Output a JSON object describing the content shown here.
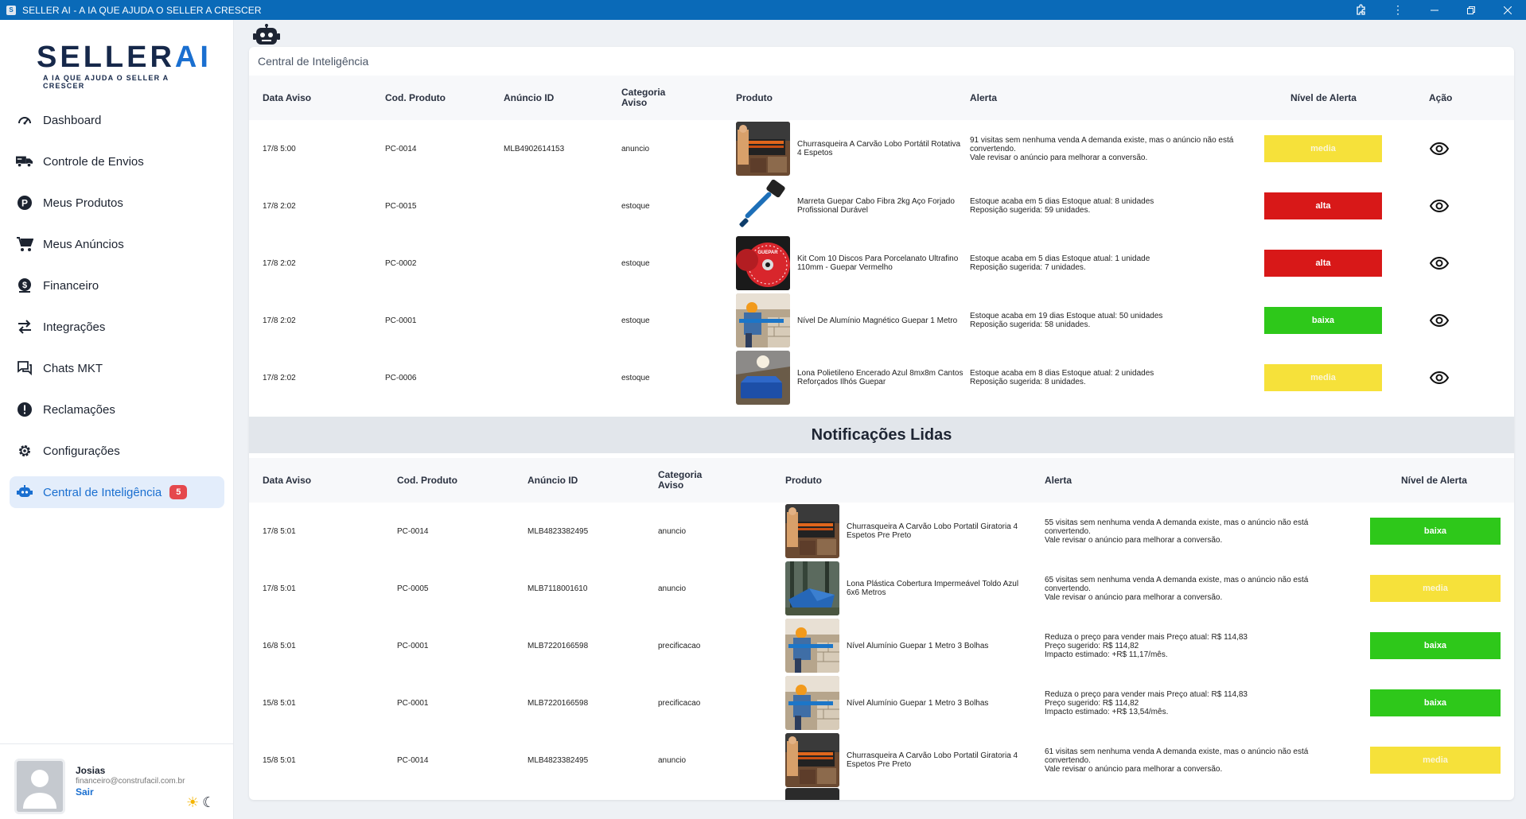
{
  "window": {
    "title": "SELLER AI - A IA QUE AJUDA O SELLER A CRESCER",
    "icon_letter": "S"
  },
  "logo": {
    "main_a": "SELLER",
    "main_b": "AI",
    "tagline": "A IA QUE AJUDA O SELLER A CRESCER"
  },
  "sidebar": {
    "items": [
      {
        "label": "Dashboard",
        "icon": "speedometer-icon"
      },
      {
        "label": "Controle de Envios",
        "icon": "truck-icon"
      },
      {
        "label": "Meus Produtos",
        "icon": "product-p-icon"
      },
      {
        "label": "Meus Anúncios",
        "icon": "cart-icon"
      },
      {
        "label": "Financeiro",
        "icon": "dollar-icon"
      },
      {
        "label": "Integrações",
        "icon": "swap-arrows-icon"
      },
      {
        "label": "Chats MKT",
        "icon": "chat-icon"
      },
      {
        "label": "Reclamações",
        "icon": "alert-icon"
      },
      {
        "label": "Configurações",
        "icon": "gear-icon"
      },
      {
        "label": "Central de Inteligência",
        "icon": "robot-icon",
        "badge": "5",
        "active": true
      }
    ]
  },
  "user": {
    "name": "Josias",
    "email": "financeiro@construfacil.com.br",
    "logout": "Sair"
  },
  "page": {
    "title": "Central de Inteligência"
  },
  "unread": {
    "headers": [
      "Data Aviso",
      "Cod. Produto",
      "Anúncio ID",
      "Categoria Aviso",
      "Produto",
      "Alerta",
      "Nível de Alerta",
      "Ação"
    ],
    "rows": [
      {
        "date": "17/8 5:00",
        "code": "PC-0014",
        "ad_id": "MLB4902614153",
        "category": "anuncio",
        "product": "Churrasqueira A Carvão Lobo Portátil Rotativa 4 Espetos",
        "img": "grill",
        "alert": "91 visitas sem nenhuma venda A demanda existe, mas o anúncio não está convertendo.\nVale revisar o anúncio para melhorar a conversão.",
        "level": "media"
      },
      {
        "date": "17/8 2:02",
        "code": "PC-0015",
        "ad_id": "",
        "category": "estoque",
        "product": "Marreta Guepar Cabo Fibra 2kg Aço Forjado Profissional Durável",
        "img": "hammer",
        "alert": "Estoque acaba em 5 dias Estoque atual: 8 unidades\nReposição sugerida: 59 unidades.",
        "level": "alta"
      },
      {
        "date": "17/8 2:02",
        "code": "PC-0002",
        "ad_id": "",
        "category": "estoque",
        "product": "Kit Com 10 Discos Para Porcelanato Ultrafino 110mm - Guepar Vermelho",
        "img": "disc",
        "alert": "Estoque acaba em 5 dias Estoque atual: 1 unidade\nReposição sugerida: 7 unidades.",
        "level": "alta"
      },
      {
        "date": "17/8 2:02",
        "code": "PC-0001",
        "ad_id": "",
        "category": "estoque",
        "product": "Nível De Alumínio Magnético Guepar 1 Metro",
        "img": "level",
        "alert": "Estoque acaba em 19 dias Estoque atual: 50 unidades\nReposição sugerida: 58 unidades.",
        "level": "baixa"
      },
      {
        "date": "17/8 2:02",
        "code": "PC-0006",
        "ad_id": "",
        "category": "estoque",
        "product": "Lona Polietileno Encerado Azul 8mx8m Cantos Reforçados Ilhós Guepar",
        "img": "tarp",
        "alert": "Estoque acaba em 8 dias Estoque atual: 2 unidades\nReposição sugerida: 8 unidades.",
        "level": "media"
      }
    ]
  },
  "read": {
    "title": "Notificações Lidas",
    "headers": [
      "Data Aviso",
      "Cod. Produto",
      "Anúncio ID",
      "Categoria Aviso",
      "Produto",
      "Alerta",
      "Nível de Alerta"
    ],
    "rows": [
      {
        "date": "17/8 5:01",
        "code": "PC-0014",
        "ad_id": "MLB4823382495",
        "category": "anuncio",
        "product": "Churrasqueira A Carvão Lobo Portatil Giratoria 4 Espetos Pre Preto",
        "img": "grill",
        "alert": "55 visitas sem nenhuma venda A demanda existe, mas o anúncio não está convertendo.\nVale revisar o anúncio para melhorar a conversão.",
        "level": "baixa"
      },
      {
        "date": "17/8 5:01",
        "code": "PC-0005",
        "ad_id": "MLB7118001610",
        "category": "anuncio",
        "product": "Lona Plástica Cobertura Impermeável Toldo Azul 6x6 Metros",
        "img": "tarp-forest",
        "alert": "65 visitas sem nenhuma venda A demanda existe, mas o anúncio não está convertendo.\nVale revisar o anúncio para melhorar a conversão.",
        "level": "media"
      },
      {
        "date": "16/8 5:01",
        "code": "PC-0001",
        "ad_id": "MLB7220166598",
        "category": "precificacao",
        "product": "Nível Alumínio Guepar 1 Metro 3 Bolhas",
        "img": "level",
        "alert": "Reduza o preço para vender mais Preço atual: R$ 114,83\nPreço sugerido: R$ 114,82\nImpacto estimado: +R$ 11,17/mês.",
        "level": "baixa"
      },
      {
        "date": "15/8 5:01",
        "code": "PC-0001",
        "ad_id": "MLB7220166598",
        "category": "precificacao",
        "product": "Nível Alumínio Guepar 1 Metro 3 Bolhas",
        "img": "level",
        "alert": "Reduza o preço para vender mais Preço atual: R$ 114,83\nPreço sugerido: R$ 114,82\nImpacto estimado: +R$ 13,54/mês.",
        "level": "baixa"
      },
      {
        "date": "15/8 5:01",
        "code": "PC-0014",
        "ad_id": "MLB4823382495",
        "category": "anuncio",
        "product": "Churrasqueira A Carvão Lobo Portatil Giratoria 4 Espetos Pre Preto",
        "img": "grill",
        "alert": "61 visitas sem nenhuma venda A demanda existe, mas o anúncio não está convertendo.\nVale revisar o anúncio para melhorar a conversão.",
        "level": "media"
      }
    ]
  },
  "colors": {
    "accent": "#1a6fd0",
    "alta": "#d81818",
    "baixa": "#2ec81a",
    "media": "#f6e13a",
    "titlebar": "#0a6ab8"
  }
}
